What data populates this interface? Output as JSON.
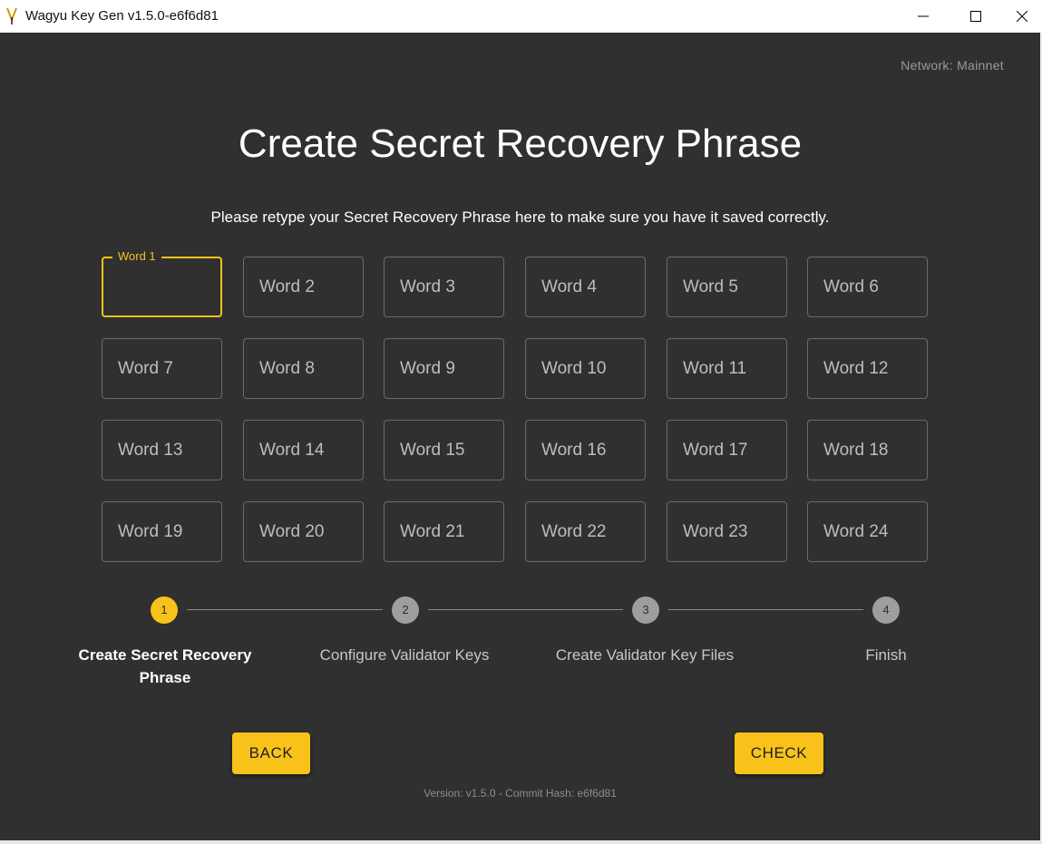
{
  "window": {
    "title": "Wagyu Key Gen v1.5.0-e6f6d81",
    "minimize_icon": "minimize-icon",
    "maximize_icon": "maximize-icon",
    "close_icon": "close-icon"
  },
  "network": "Network: Mainnet",
  "heading": "Create Secret Recovery Phrase",
  "instructions": "Please retype your Secret Recovery Phrase here to make sure you have it saved correctly.",
  "words": [
    {
      "label": "Word 1",
      "value": "",
      "focused": true
    },
    {
      "label": "Word 2",
      "value": ""
    },
    {
      "label": "Word 3",
      "value": ""
    },
    {
      "label": "Word 4",
      "value": ""
    },
    {
      "label": "Word 5",
      "value": ""
    },
    {
      "label": "Word 6",
      "value": ""
    },
    {
      "label": "Word 7",
      "value": ""
    },
    {
      "label": "Word 8",
      "value": ""
    },
    {
      "label": "Word 9",
      "value": ""
    },
    {
      "label": "Word 10",
      "value": ""
    },
    {
      "label": "Word 11",
      "value": ""
    },
    {
      "label": "Word 12",
      "value": ""
    },
    {
      "label": "Word 13",
      "value": ""
    },
    {
      "label": "Word 14",
      "value": ""
    },
    {
      "label": "Word 15",
      "value": ""
    },
    {
      "label": "Word 16",
      "value": ""
    },
    {
      "label": "Word 17",
      "value": ""
    },
    {
      "label": "Word 18",
      "value": ""
    },
    {
      "label": "Word 19",
      "value": ""
    },
    {
      "label": "Word 20",
      "value": ""
    },
    {
      "label": "Word 21",
      "value": ""
    },
    {
      "label": "Word 22",
      "value": ""
    },
    {
      "label": "Word 23",
      "value": ""
    },
    {
      "label": "Word 24",
      "value": ""
    }
  ],
  "stepper": [
    {
      "number": "1",
      "label": "Create Secret Recovery Phrase",
      "active": true
    },
    {
      "number": "2",
      "label": "Configure Validator Keys",
      "active": false
    },
    {
      "number": "3",
      "label": "Create Validator Key Files",
      "active": false
    },
    {
      "number": "4",
      "label": "Finish",
      "active": false
    }
  ],
  "buttons": {
    "back": "BACK",
    "check": "CHECK"
  },
  "footer": "Version: v1.5.0 - Commit Hash: e6f6d81",
  "colors": {
    "accent": "#f8c21b",
    "background": "#303030",
    "step_inactive": "#9e9e9e"
  }
}
